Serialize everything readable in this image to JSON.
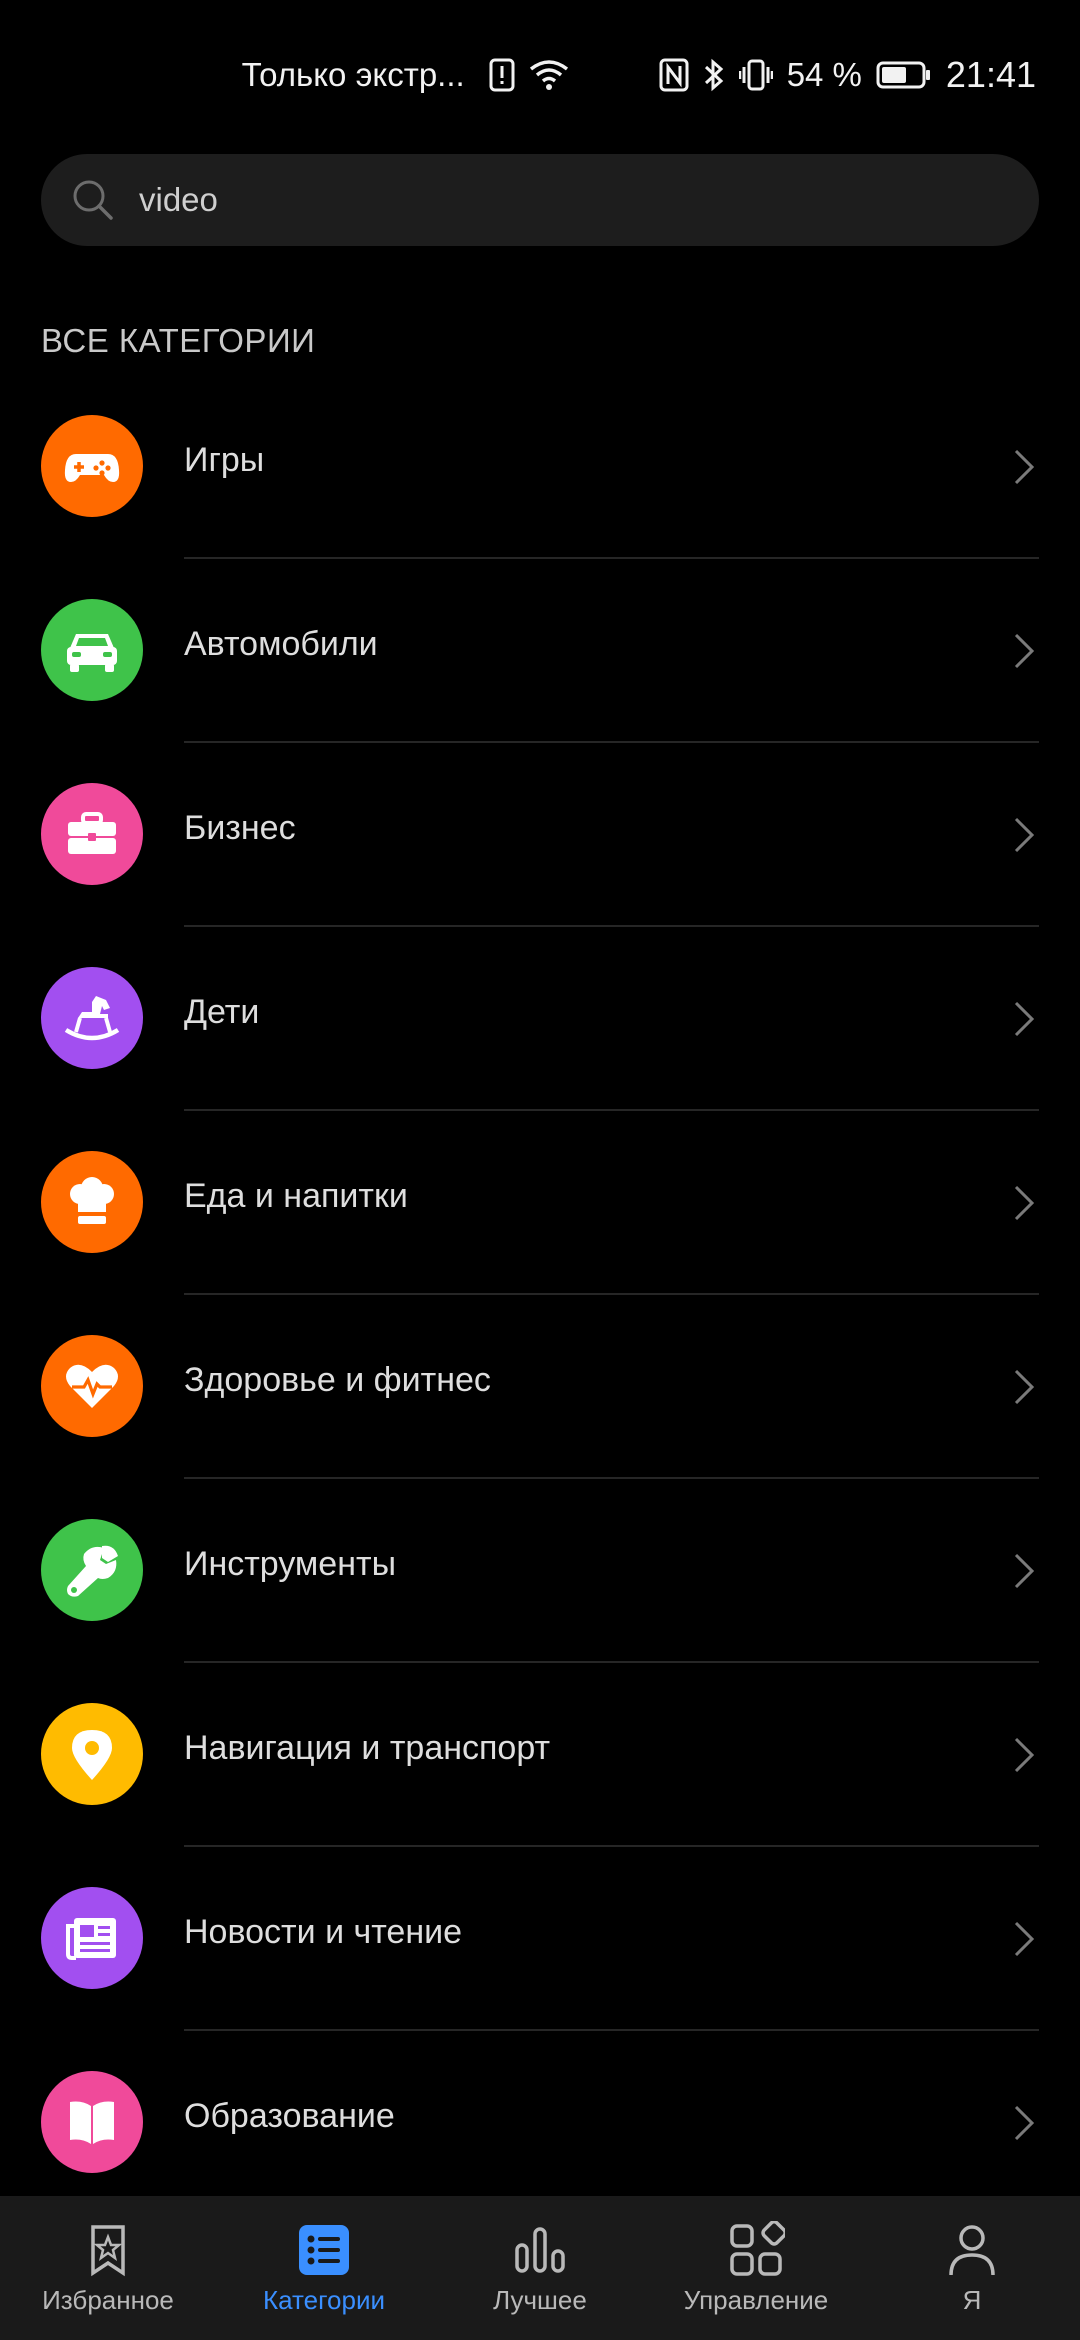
{
  "status_bar": {
    "carrier": "Только экстр...",
    "battery": "54 %",
    "time": "21:41"
  },
  "search": {
    "value": "video"
  },
  "section_title": "ВСЕ КАТЕГОРИИ",
  "categories": [
    {
      "label": "Игры",
      "color": "#ff6a00",
      "icon": "gamepad-icon"
    },
    {
      "label": "Автомобили",
      "color": "#3fc34a",
      "icon": "car-icon"
    },
    {
      "label": "Бизнес",
      "color": "#f04a9a",
      "icon": "briefcase-icon"
    },
    {
      "label": "Дети",
      "color": "#a24ff0",
      "icon": "rocking-horse-icon"
    },
    {
      "label": "Еда и напитки",
      "color": "#ff6a00",
      "icon": "chef-hat-icon"
    },
    {
      "label": "Здоровье и фитнес",
      "color": "#ff6a00",
      "icon": "heart-pulse-icon"
    },
    {
      "label": "Инструменты",
      "color": "#3fc34a",
      "icon": "wrench-icon"
    },
    {
      "label": "Навигация и транспорт",
      "color": "#ffbb00",
      "icon": "location-pin-icon"
    },
    {
      "label": "Новости и чтение",
      "color": "#a24ff0",
      "icon": "newspaper-icon"
    },
    {
      "label": "Образование",
      "color": "#f04a9a",
      "icon": "book-icon"
    }
  ],
  "bottom_nav": [
    {
      "label": "Избранное",
      "icon": "star-bookmark-icon",
      "active": false
    },
    {
      "label": "Категории",
      "icon": "categories-icon",
      "active": true
    },
    {
      "label": "Лучшее",
      "icon": "bar-chart-icon",
      "active": false
    },
    {
      "label": "Управление",
      "icon": "apps-grid-icon",
      "active": false
    },
    {
      "label": "Я",
      "icon": "person-icon",
      "active": false
    }
  ],
  "colors": {
    "accent": "#3a8fff",
    "background": "#000000",
    "search_bg": "#1d1d1d",
    "nav_bg": "#1a1a1a"
  }
}
